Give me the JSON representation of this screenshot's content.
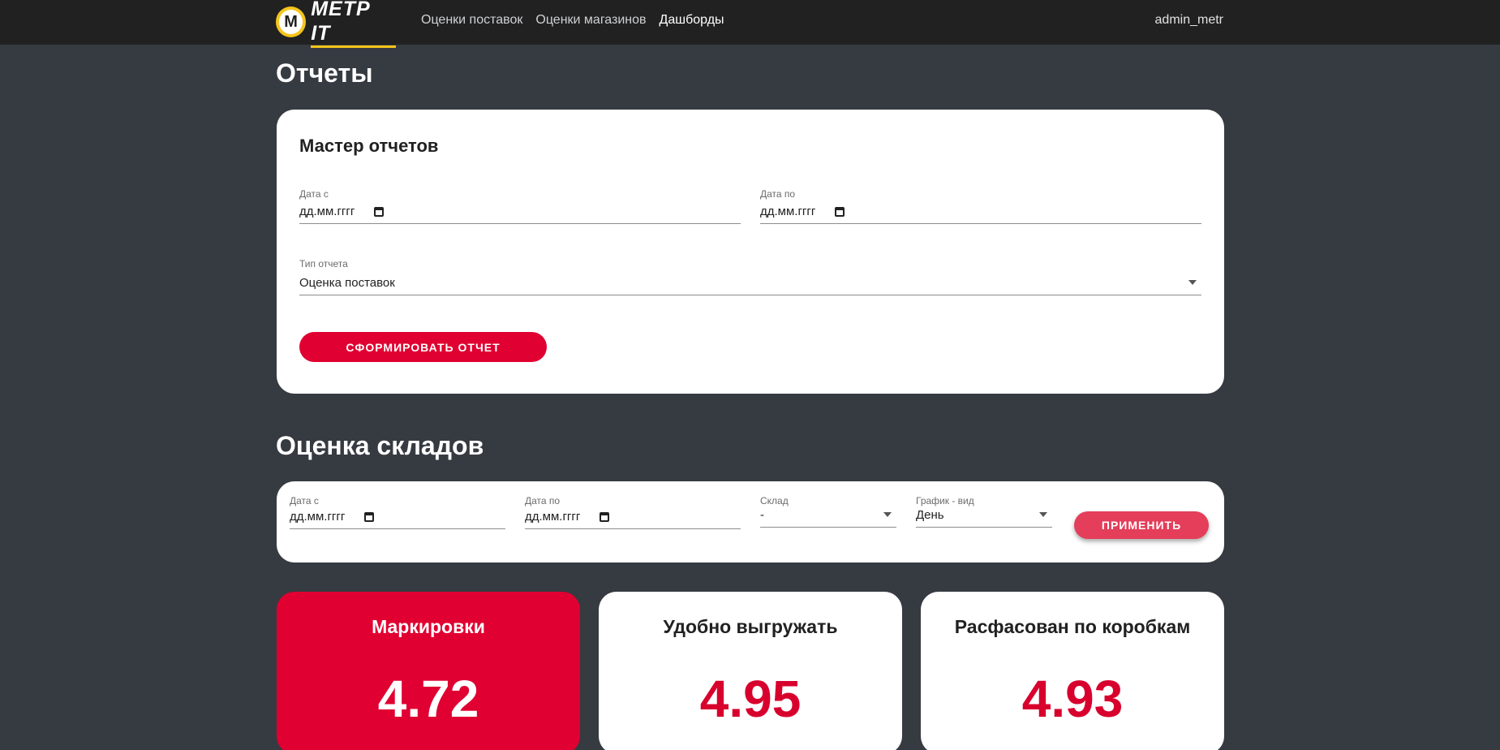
{
  "header": {
    "logo_letter": "M",
    "logo_text": "МЕТР IT",
    "nav": [
      {
        "label": "Оценки поставок"
      },
      {
        "label": "Оценки магазинов"
      },
      {
        "label": "Дашборды"
      }
    ],
    "user": "admin_metr"
  },
  "reports": {
    "heading": "Отчеты",
    "card_title": "Мастер отчетов",
    "date_from_label": "Дата с",
    "date_from_value": "дд.мм.гггг",
    "date_to_label": "Дата по",
    "date_to_value": "дд.мм.гггг",
    "type_label": "Тип отчета",
    "type_value": "Оценка поставок",
    "generate_button": "СФОРМИРОВАТЬ ОТЧЕТ"
  },
  "warehouses": {
    "heading": "Оценка складов",
    "date_from_label": "Дата с",
    "date_from_value": "дд.мм.гггг",
    "date_to_label": "Дата по",
    "date_to_value": "дд.мм.гггг",
    "warehouse_label": "Склад",
    "warehouse_value": "-",
    "chart_view_label": "График - вид",
    "chart_view_value": "День",
    "apply_button": "ПРИМЕНИТЬ"
  },
  "metrics": [
    {
      "title": "Маркировки",
      "value": "4.72"
    },
    {
      "title": "Удобно выгружать",
      "value": "4.95"
    },
    {
      "title": "Расфасован по коробкам",
      "value": "4.93"
    }
  ],
  "colors": {
    "background": "#363a41",
    "topbar": "#212121",
    "accent_red": "#e00031",
    "logo_yellow": "#f4c51b"
  }
}
